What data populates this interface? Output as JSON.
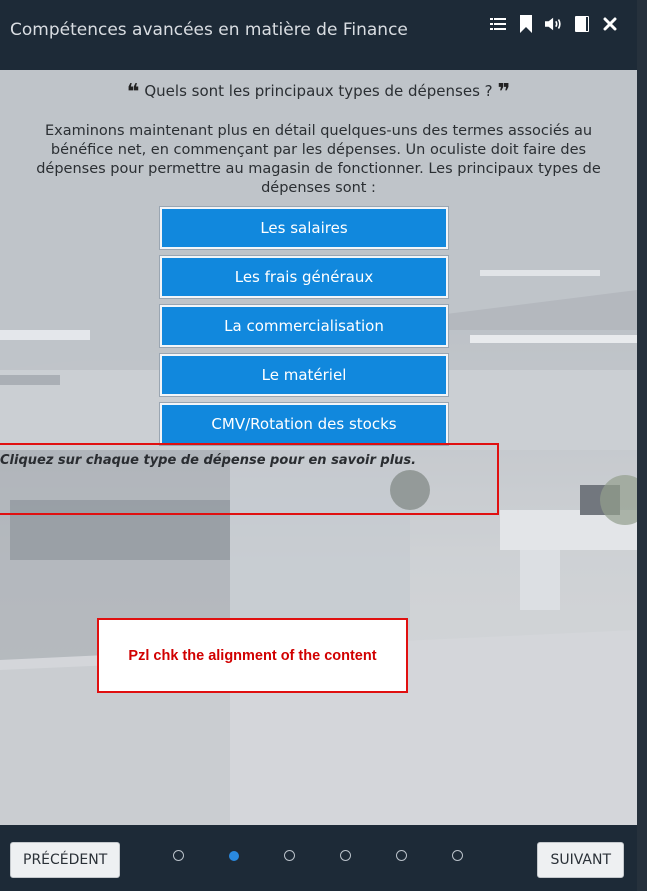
{
  "header": {
    "title": "Compétences avancées en matière de Finance",
    "icons": [
      "list-icon",
      "bookmark-icon",
      "audio-icon",
      "book-icon",
      "close-icon"
    ]
  },
  "content": {
    "question": "Quels sont les principaux types de dépenses ?",
    "open_quote": "❝",
    "close_quote": "❞",
    "intro": "Examinons maintenant plus en détail quelques-uns des termes associés au bénéfice net, en commençant par les dépenses. Un oculiste doit faire des dépenses pour permettre au magasin de fonctionner. Les principaux types de dépenses sont :",
    "buttons": [
      "Les salaires",
      "Les frais généraux",
      "La commercialisation",
      "Le matériel",
      "CMV/Rotation des stocks"
    ],
    "hint": "Cliquez sur chaque type de dépense pour en savoir plus.",
    "review_note": "Pzl chk the alignment of the content"
  },
  "footer": {
    "prev_label": "PRÉCÉDENT",
    "next_label": "SUIVANT",
    "page_count": 6,
    "active_page": 2
  },
  "colors": {
    "header_bg": "#1d2a37",
    "button_bg": "#1188dd",
    "accent_red": "#e01010",
    "active_dot": "#2a8ae0"
  }
}
